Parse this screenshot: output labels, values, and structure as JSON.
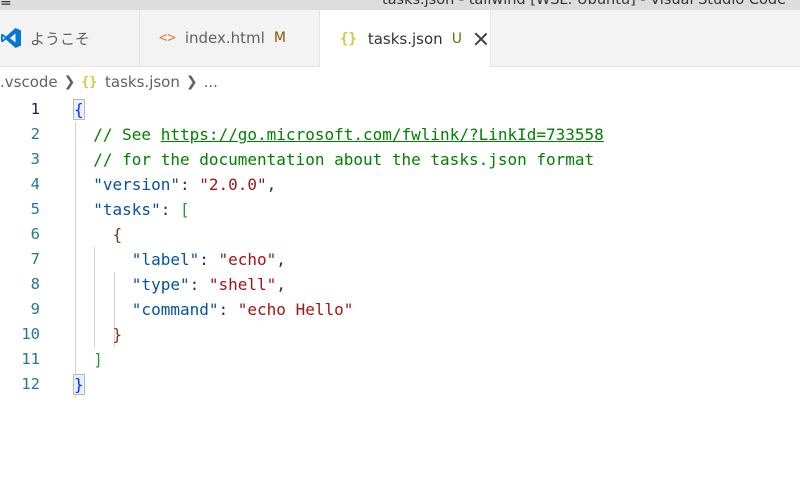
{
  "window": {
    "menu_glyph": "≡",
    "title": "tasks.json - tailwind [WSL: Ubuntu] - Visual Studio Code"
  },
  "tabs": [
    {
      "label": "ようこそ",
      "icon": "vscode-logo-icon",
      "status": "",
      "active": false
    },
    {
      "label": "index.html",
      "icon": "html-file-icon",
      "icon_glyph": "<>",
      "status": "M",
      "active": false
    },
    {
      "label": "tasks.json",
      "icon": "json-file-icon",
      "icon_glyph": "{}",
      "status": "U",
      "active": true,
      "close_icon": "close-icon"
    }
  ],
  "breadcrumb": {
    "folder": ".vscode",
    "file_icon_glyph": "{}",
    "file": "tasks.json",
    "tail": "..."
  },
  "editor": {
    "language": "json",
    "active_line": 1,
    "lines": [
      {
        "n": "1",
        "t": [
          {
            "c": "b1",
            "v": "{"
          }
        ]
      },
      {
        "n": "2",
        "t": [
          {
            "c": "c",
            "v": "  // See "
          },
          {
            "c": "c-link",
            "v": "https://go.microsoft.com/fwlink/?LinkId=733558"
          }
        ]
      },
      {
        "n": "3",
        "t": [
          {
            "c": "c",
            "v": "  // for the documentation about the tasks.json format"
          }
        ]
      },
      {
        "n": "4",
        "t": [
          {
            "c": "k",
            "v": "  \"version\""
          },
          {
            "c": "p",
            "v": ": "
          },
          {
            "c": "s",
            "v": "\"2.0.0\""
          },
          {
            "c": "p",
            "v": ","
          }
        ]
      },
      {
        "n": "5",
        "t": [
          {
            "c": "k",
            "v": "  \"tasks\""
          },
          {
            "c": "p",
            "v": ": "
          },
          {
            "c": "b2",
            "v": "["
          }
        ]
      },
      {
        "n": "6",
        "t": [
          {
            "c": "b3",
            "v": "    {"
          }
        ]
      },
      {
        "n": "7",
        "t": [
          {
            "c": "k",
            "v": "      \"label\""
          },
          {
            "c": "p",
            "v": ": "
          },
          {
            "c": "s",
            "v": "\"echo\""
          },
          {
            "c": "p",
            "v": ","
          }
        ]
      },
      {
        "n": "8",
        "t": [
          {
            "c": "k",
            "v": "      \"type\""
          },
          {
            "c": "p",
            "v": ": "
          },
          {
            "c": "s",
            "v": "\"shell\""
          },
          {
            "c": "p",
            "v": ","
          }
        ]
      },
      {
        "n": "9",
        "t": [
          {
            "c": "k",
            "v": "      \"command\""
          },
          {
            "c": "p",
            "v": ": "
          },
          {
            "c": "s",
            "v": "\"echo Hello\""
          }
        ]
      },
      {
        "n": "10",
        "t": [
          {
            "c": "b3",
            "v": "    }"
          }
        ]
      },
      {
        "n": "11",
        "t": [
          {
            "c": "b2",
            "v": "  ]"
          }
        ]
      },
      {
        "n": "12",
        "t": [
          {
            "c": "b1",
            "v": "}"
          }
        ]
      }
    ]
  }
}
